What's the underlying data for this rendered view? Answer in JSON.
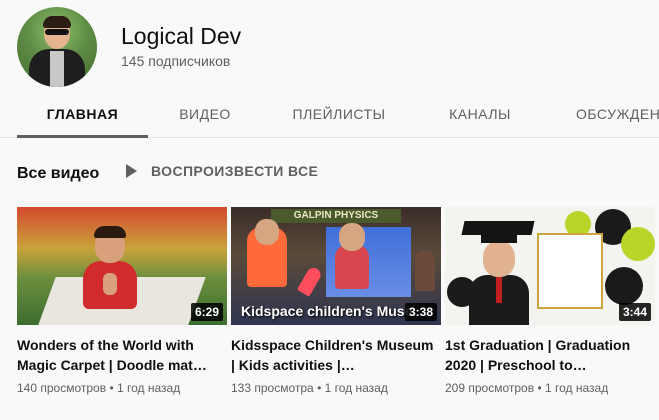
{
  "channel": {
    "name": "Logical Dev",
    "subscribers": "145 подписчиков"
  },
  "tabs": [
    {
      "label": "ГЛАВНАЯ",
      "active": true
    },
    {
      "label": "ВИДЕО",
      "active": false
    },
    {
      "label": "ПЛЕЙЛИСТЫ",
      "active": false
    },
    {
      "label": "КАНАЛЫ",
      "active": false
    },
    {
      "label": "ОБСУЖДЕН",
      "active": false
    }
  ],
  "section": {
    "title": "Все видео",
    "play_all": "ВОСПРОИЗВЕСТИ ВСЕ",
    "play_icon": "play-icon"
  },
  "videos": [
    {
      "title": "Wonders of the World with Magic Carpet | Doodle mat…",
      "duration": "6:29",
      "views": "140 просмотров",
      "age": "1 год назад"
    },
    {
      "title": "Kidsspace Children's Museum | Kids activities |…",
      "duration": "3:38",
      "views": "133 просмотра",
      "age": "1 год назад",
      "thumb_text": "Kidspace children's Muse",
      "thumb_banner": "GALPIN PHYSICS"
    },
    {
      "title": "1st Graduation | Graduation 2020 | Preschool to…",
      "duration": "3:44",
      "views": "209 просмотров",
      "age": "1 год назад"
    }
  ],
  "colors": {
    "background": "#f9f9f9",
    "text_primary": "#0f0f0f",
    "text_secondary": "#606060"
  }
}
